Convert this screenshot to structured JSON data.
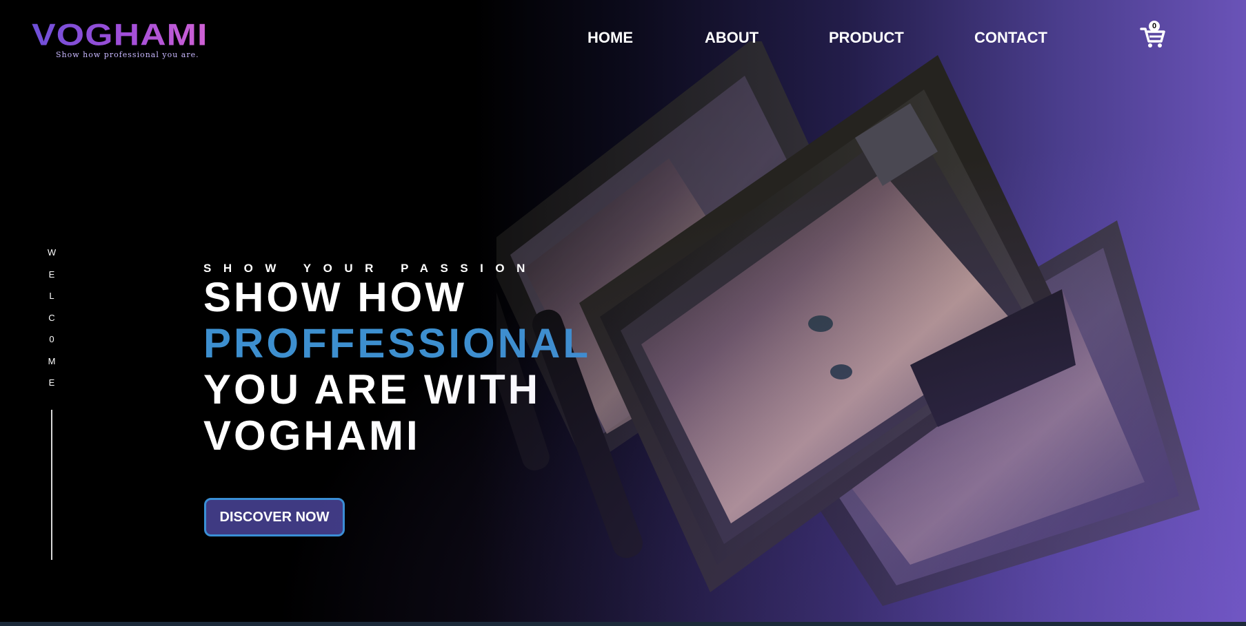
{
  "brand": {
    "name": "VOGHAMI",
    "tagline": "Show how professional you are."
  },
  "nav": {
    "items": [
      {
        "label": "HOME"
      },
      {
        "label": "ABOUT"
      },
      {
        "label": "PRODUCT"
      },
      {
        "label": "CONTACT"
      }
    ],
    "cart_icon": "cart-icon",
    "cart_count": "0"
  },
  "side": {
    "welcome_letters": [
      "W",
      "E",
      "L",
      "C",
      "0",
      "M",
      "E"
    ]
  },
  "hero": {
    "kicker": "SHOW YOUR PASSION",
    "line1": "SHOW HOW",
    "line2": "PROFFESSIONAL",
    "line3": "YOU ARE WITH",
    "line4": "VOGHAMI",
    "cta_label": "DISCOVER NOW"
  },
  "colors": {
    "accent": "#3d8fcf",
    "button_bg": "#3f3a82",
    "button_border": "#3a8fd6",
    "gradient_end": "#6a53b8"
  }
}
